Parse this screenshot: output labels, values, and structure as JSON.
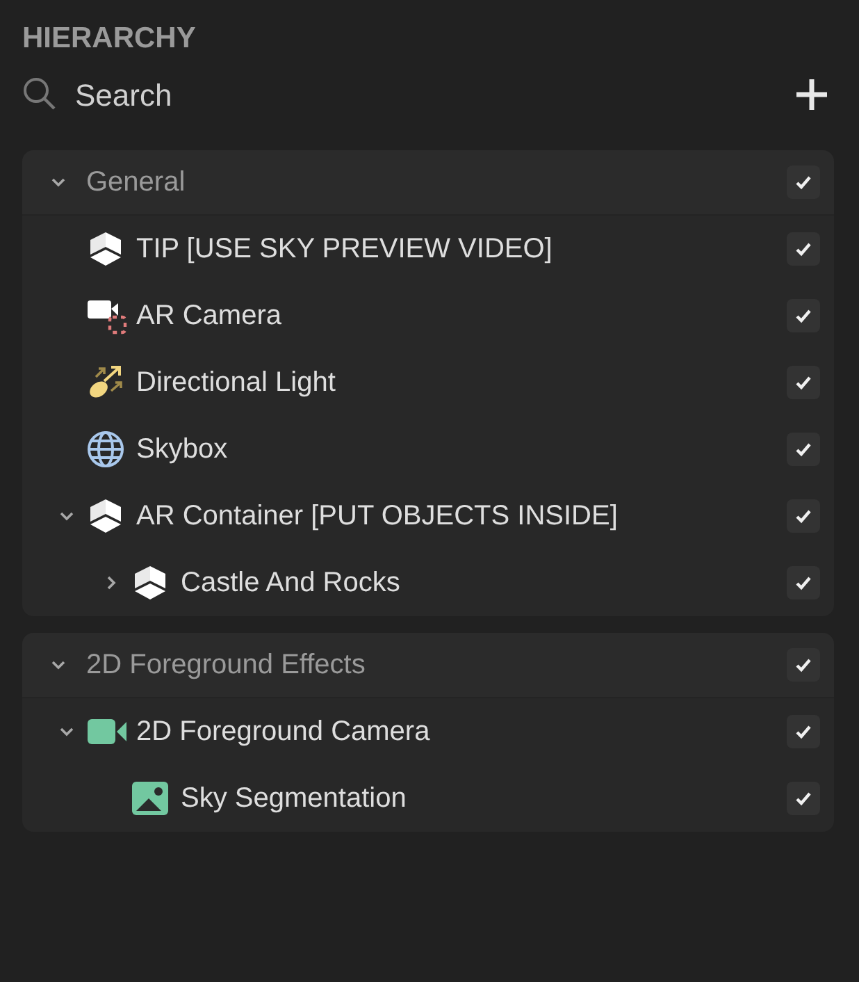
{
  "title": "HIERARCHY",
  "search": {
    "placeholder": "Search"
  },
  "groups": [
    {
      "label": "General",
      "expanded": true,
      "checked": true,
      "items": [
        {
          "label": "TIP [USE SKY PREVIEW VIDEO]",
          "kind": "object",
          "checked": true
        },
        {
          "label": "AR Camera",
          "kind": "ar-camera",
          "checked": true
        },
        {
          "label": "Directional Light",
          "kind": "light",
          "checked": true
        },
        {
          "label": "Skybox",
          "kind": "skybox",
          "checked": true
        },
        {
          "label": "AR Container [PUT OBJECTS INSIDE]",
          "kind": "object",
          "checked": true,
          "expanded": true,
          "children": [
            {
              "label": "Castle And Rocks",
              "kind": "object",
              "checked": true,
              "expanded": false
            }
          ]
        }
      ]
    },
    {
      "label": "2D Foreground Effects",
      "expanded": true,
      "checked": true,
      "items": [
        {
          "label": "2D Foreground Camera",
          "kind": "camera",
          "checked": true,
          "expanded": true,
          "children": [
            {
              "label": "Sky Segmentation",
              "kind": "image",
              "checked": true
            }
          ]
        }
      ]
    }
  ]
}
